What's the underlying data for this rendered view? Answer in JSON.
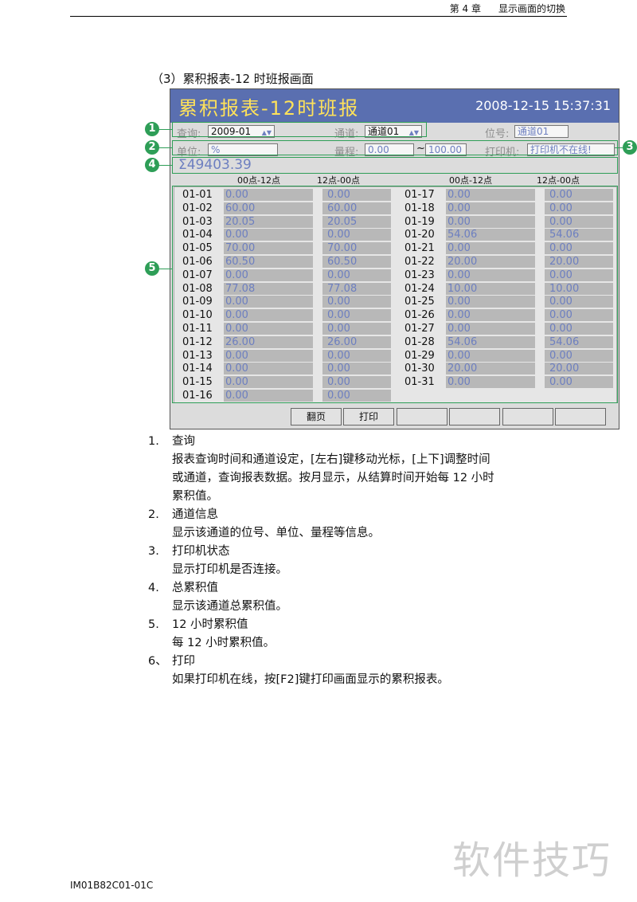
{
  "header": {
    "chapter": "第 4 章",
    "section": "显示画面的切换"
  },
  "section_title": "（3）累积报表-12 时班报画面",
  "screen": {
    "title": "累积报表-12时班报",
    "datetime": "2008-12-15  15:37:31",
    "query_label": "查询:",
    "query_value": "2009-01",
    "channel_label": "通道:",
    "channel_value": "通道01",
    "tag_label": "位号:",
    "tag_value": "通道01",
    "unit_label": "单位:",
    "unit_value": "%",
    "range_label": "量程:",
    "range_low": "0.00",
    "range_sep": "~",
    "range_high": "100.00",
    "printer_label": "打印机:",
    "printer_value": "打印机不在线!",
    "total": "Σ49403.39",
    "col_headers": [
      "00点-12点",
      "12点-00点",
      "00点-12点",
      "12点-00点"
    ],
    "rows_left": [
      [
        "01-01",
        "0.00",
        "0.00"
      ],
      [
        "01-02",
        "60.00",
        "60.00"
      ],
      [
        "01-03",
        "20.05",
        "20.05"
      ],
      [
        "01-04",
        "0.00",
        "0.00"
      ],
      [
        "01-05",
        "70.00",
        "70.00"
      ],
      [
        "01-06",
        "60.50",
        "60.50"
      ],
      [
        "01-07",
        "0.00",
        "0.00"
      ],
      [
        "01-08",
        "77.08",
        "77.08"
      ],
      [
        "01-09",
        "0.00",
        "0.00"
      ],
      [
        "01-10",
        "0.00",
        "0.00"
      ],
      [
        "01-11",
        "0.00",
        "0.00"
      ],
      [
        "01-12",
        "26.00",
        "26.00"
      ],
      [
        "01-13",
        "0.00",
        "0.00"
      ],
      [
        "01-14",
        "0.00",
        "0.00"
      ],
      [
        "01-15",
        "0.00",
        "0.00"
      ],
      [
        "01-16",
        "0.00",
        "0.00"
      ]
    ],
    "rows_right": [
      [
        "01-17",
        "0.00",
        "0.00"
      ],
      [
        "01-18",
        "0.00",
        "0.00"
      ],
      [
        "01-19",
        "0.00",
        "0.00"
      ],
      [
        "01-20",
        "54.06",
        "54.06"
      ],
      [
        "01-21",
        "0.00",
        "0.00"
      ],
      [
        "01-22",
        "20.00",
        "20.00"
      ],
      [
        "01-23",
        "0.00",
        "0.00"
      ],
      [
        "01-24",
        "10.00",
        "10.00"
      ],
      [
        "01-25",
        "0.00",
        "0.00"
      ],
      [
        "01-26",
        "0.00",
        "0.00"
      ],
      [
        "01-27",
        "0.00",
        "0.00"
      ],
      [
        "01-28",
        "54.06",
        "54.06"
      ],
      [
        "01-29",
        "0.00",
        "0.00"
      ],
      [
        "01-30",
        "20.00",
        "20.00"
      ],
      [
        "01-31",
        "0.00",
        "0.00"
      ]
    ],
    "buttons": [
      "翻页",
      "打印",
      "",
      "",
      "",
      ""
    ]
  },
  "callouts": [
    "1",
    "2",
    "3",
    "4",
    "5"
  ],
  "items": [
    {
      "num": "1.",
      "title": "查询",
      "desc": [
        "报表查询时间和通道设定，[左右]键移动光标，[上下]调整时间",
        "或通道，查询报表数据。按月显示，从结算时间开始每 12 小时",
        "累积值。"
      ]
    },
    {
      "num": "2.",
      "title": "通道信息",
      "desc": [
        "显示该通道的位号、单位、量程等信息。"
      ]
    },
    {
      "num": "3.",
      "title": "打印机状态",
      "desc": [
        "显示打印机是否连接。"
      ]
    },
    {
      "num": "4.",
      "title": "总累积值",
      "desc": [
        "显示该通道总累积值。"
      ]
    },
    {
      "num": "5.",
      "title": "12 小时累积值",
      "desc": [
        "每 12 小时累积值。"
      ]
    },
    {
      "num": "6、",
      "title": "打印",
      "desc": [
        "如果打印机在线，按[F2]键打印画面显示的累积报表。"
      ]
    }
  ],
  "footer": "IM01B82C01-01C",
  "watermark": "软件技巧",
  "colors": {
    "title_bar": "#5a6fb0",
    "title_text": "#ffe25a",
    "value_text": "#6d7fc0",
    "callout": "#2e9e57"
  }
}
